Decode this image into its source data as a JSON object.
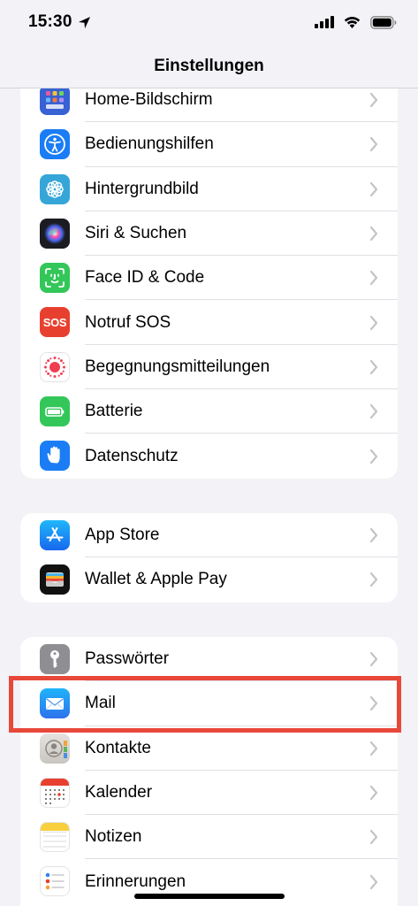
{
  "status_bar": {
    "time": "15:30"
  },
  "nav": {
    "title": "Einstellungen"
  },
  "group1": [
    {
      "label": "Home-Bildschirm",
      "icon": "home-screen-icon",
      "color": "#3761d4"
    },
    {
      "label": "Bedienungshilfen",
      "icon": "accessibility-icon",
      "color": "#1a7df5"
    },
    {
      "label": "Hintergrundbild",
      "icon": "wallpaper-icon",
      "color": "#36a6d8"
    },
    {
      "label": "Siri & Suchen",
      "icon": "siri-icon",
      "color": "#222222"
    },
    {
      "label": "Face ID & Code",
      "icon": "face-id-icon",
      "color": "#33c759"
    },
    {
      "label": "Notruf SOS",
      "icon": "sos-icon",
      "color": "#e8402f"
    },
    {
      "label": "Begegnungsmitteilungen",
      "icon": "exposure-notification-icon",
      "color": "#ffffff"
    },
    {
      "label": "Batterie",
      "icon": "battery-icon",
      "color": "#33c759"
    },
    {
      "label": "Datenschutz",
      "icon": "privacy-hand-icon",
      "color": "#1a7df5"
    }
  ],
  "group2": [
    {
      "label": "App Store",
      "icon": "app-store-icon",
      "color": "#1a8cf5"
    },
    {
      "label": "Wallet & Apple Pay",
      "icon": "wallet-icon",
      "color": "#111111"
    }
  ],
  "group3": [
    {
      "label": "Passwörter",
      "icon": "key-icon",
      "color": "#8e8e93"
    },
    {
      "label": "Mail",
      "icon": "mail-icon",
      "color": "#2f8cf0"
    },
    {
      "label": "Kontakte",
      "icon": "contacts-icon",
      "color": "#d8d4cf"
    },
    {
      "label": "Kalender",
      "icon": "calendar-icon",
      "color": "#ffffff"
    },
    {
      "label": "Notizen",
      "icon": "notes-icon",
      "color": "#ffffff"
    },
    {
      "label": "Erinnerungen",
      "icon": "reminders-icon",
      "color": "#ffffff"
    }
  ],
  "highlight_color": "#e8483a"
}
